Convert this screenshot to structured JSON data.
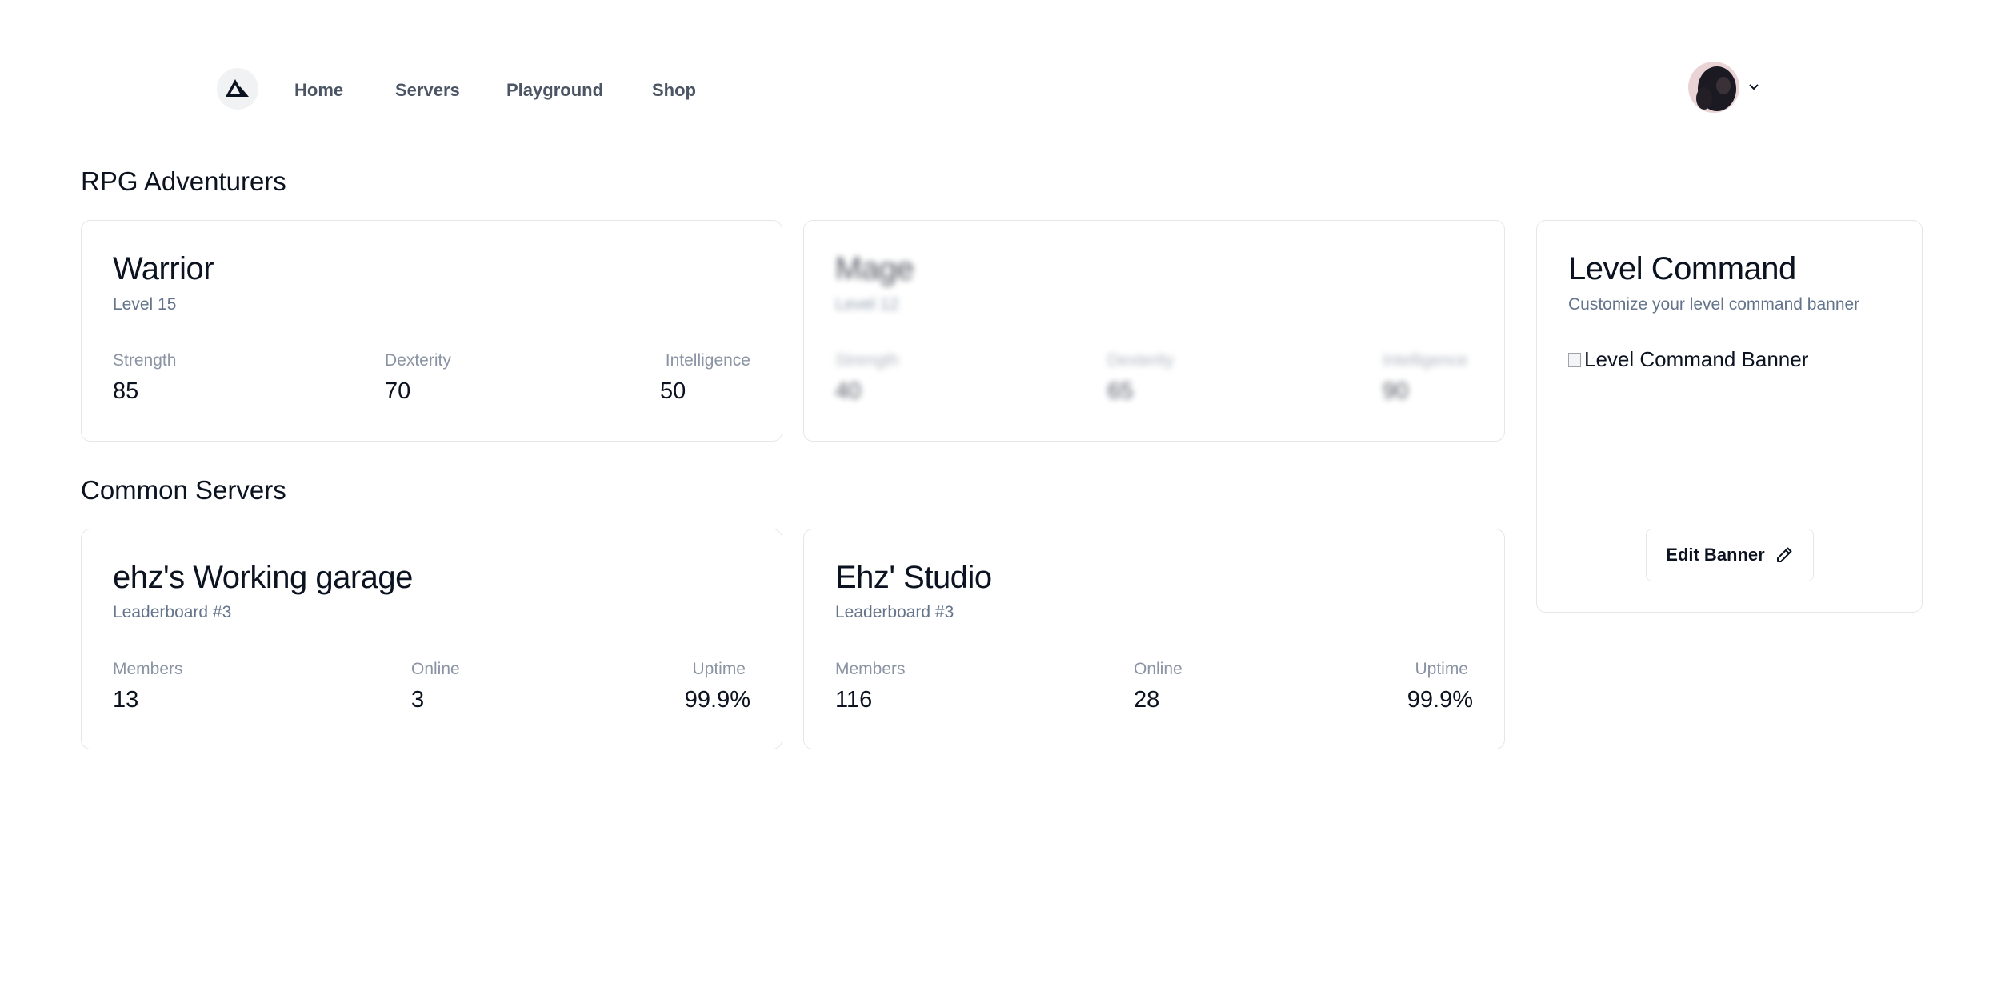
{
  "nav": {
    "links": [
      "Home",
      "Servers",
      "Playground",
      "Shop"
    ]
  },
  "sections": {
    "rpg_title": "RPG Adventurers",
    "servers_title": "Common Servers"
  },
  "characters": [
    {
      "name": "Warrior",
      "level": "Level 15",
      "stats": [
        {
          "label": "Strength",
          "value": "85"
        },
        {
          "label": "Dexterity",
          "value": "70"
        },
        {
          "label": "Intelligence",
          "value": "50"
        }
      ]
    },
    {
      "name": "Mage",
      "level": "Level 12",
      "stats": [
        {
          "label": "Strength",
          "value": "40"
        },
        {
          "label": "Dexterity",
          "value": "65"
        },
        {
          "label": "Intelligence",
          "value": "90"
        }
      ]
    }
  ],
  "servers": [
    {
      "name": "ehz's Working garage",
      "rank": "Leaderboard #3",
      "stats": [
        {
          "label": "Members",
          "value": "13"
        },
        {
          "label": "Online",
          "value": "3"
        },
        {
          "label": "Uptime",
          "value": "99.9%"
        }
      ]
    },
    {
      "name": "Ehz' Studio",
      "rank": "Leaderboard #3",
      "stats": [
        {
          "label": "Members",
          "value": "116"
        },
        {
          "label": "Online",
          "value": "28"
        },
        {
          "label": "Uptime",
          "value": "99.9%"
        }
      ]
    }
  ],
  "level_command": {
    "title": "Level Command",
    "subtitle": "Customize your level command banner",
    "banner_alt": "Level Command Banner",
    "edit_label": "Edit Banner"
  },
  "icons": {
    "logo": "triangle-logo-icon",
    "chevron": "chevron-down-icon",
    "edit": "pencil-icon"
  }
}
